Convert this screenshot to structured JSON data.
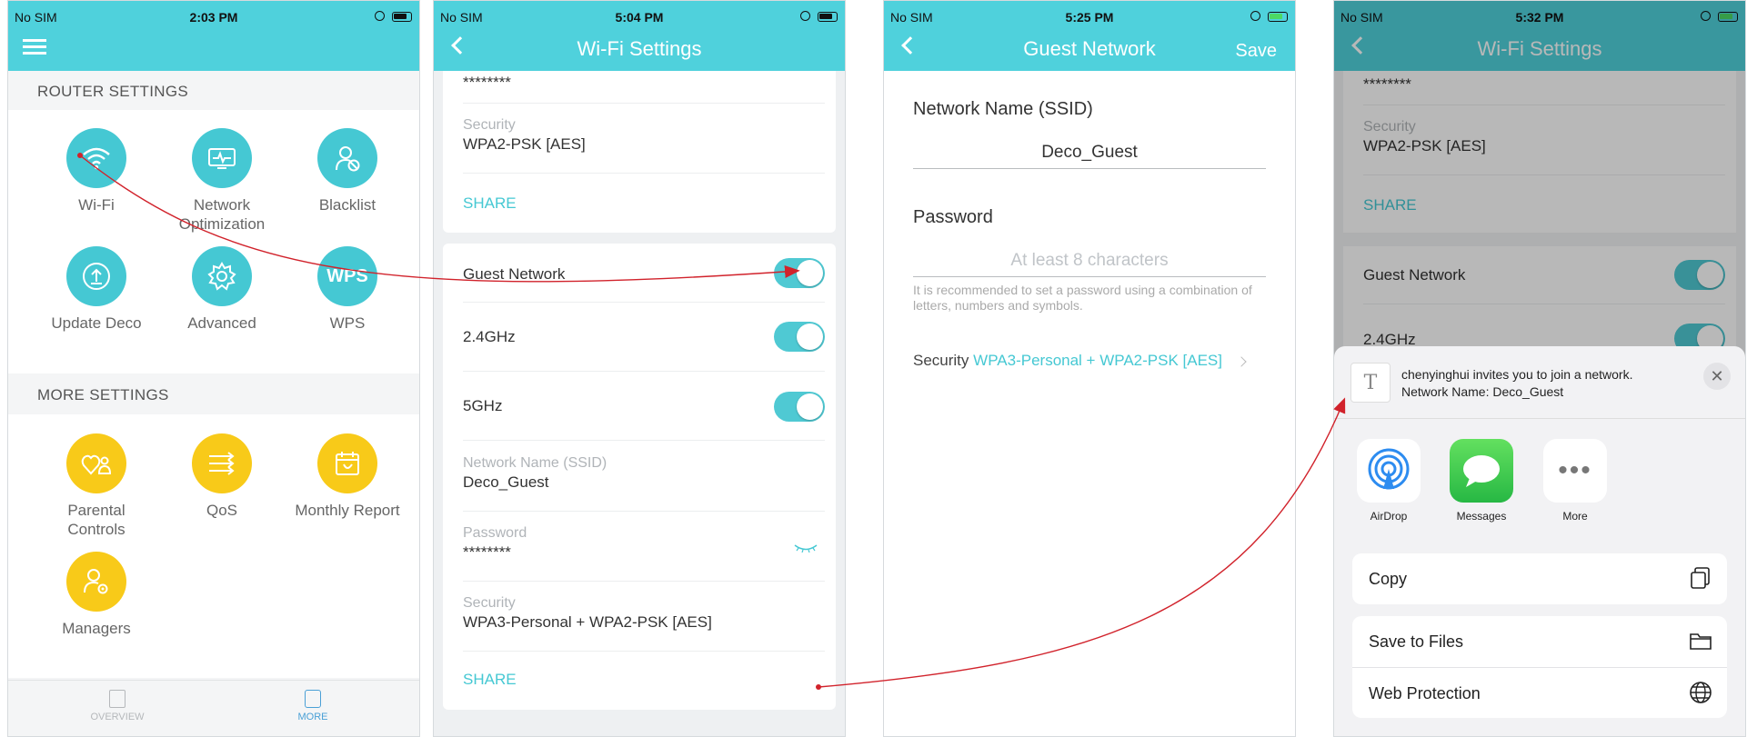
{
  "colors": {
    "accent": "#4fd1dc",
    "yellow": "#f8ca19",
    "arrow": "#d1222b",
    "link": "#45c8d3"
  },
  "phone1": {
    "status": {
      "carrier": "No SIM",
      "time": "2:03 PM"
    },
    "menu_icon": "hamburger-icon",
    "router_settings_label": "ROUTER SETTINGS",
    "router_tiles": [
      {
        "label": "Wi-Fi",
        "icon": "wifi-icon"
      },
      {
        "label": "Network Optimization",
        "icon": "network-optimization-icon"
      },
      {
        "label": "Blacklist",
        "icon": "blacklist-icon"
      },
      {
        "label": "Update Deco",
        "icon": "upload-icon"
      },
      {
        "label": "Advanced",
        "icon": "gear-icon"
      },
      {
        "label": "WPS",
        "icon": "wps-icon",
        "badge": "WPS"
      }
    ],
    "more_settings_label": "MORE SETTINGS",
    "more_tiles": [
      {
        "label": "Parental Controls",
        "icon": "parental-controls-icon"
      },
      {
        "label": "QoS",
        "icon": "qos-icon"
      },
      {
        "label": "Monthly Report",
        "icon": "calendar-icon"
      },
      {
        "label": "Managers",
        "icon": "managers-icon"
      }
    ],
    "tabbar": {
      "overview": "OVERVIEW",
      "more": "MORE"
    }
  },
  "phone2": {
    "status": {
      "carrier": "No SIM",
      "time": "5:04 PM"
    },
    "title": "Wi-Fi Settings",
    "top_password": "********",
    "top_security_label": "Security",
    "top_security_value": "WPA2-PSK [AES]",
    "share": "SHARE",
    "guest_network": "Guest Network",
    "band_24": "2.4GHz",
    "band_5": "5GHz",
    "ssid_label": "Network Name (SSID)",
    "ssid_value": "Deco_Guest",
    "password_label": "Password",
    "password_value": "********",
    "security_label": "Security",
    "security_value": "WPA3-Personal + WPA2-PSK [AES]",
    "share2": "SHARE"
  },
  "phone3": {
    "status": {
      "carrier": "No SIM",
      "time": "5:25 PM"
    },
    "title": "Guest Network",
    "save": "Save",
    "ssid_label": "Network Name (SSID)",
    "ssid_value": "Deco_Guest",
    "password_label": "Password",
    "password_placeholder": "At least 8 characters",
    "hint": "It is recommended to set a password using a combination of letters, numbers and symbols.",
    "security_label": "Security",
    "security_value": "WPA3-Personal + WPA2-PSK [AES]"
  },
  "phone4": {
    "status": {
      "carrier": "No SIM",
      "time": "5:32 PM"
    },
    "title": "Wi-Fi Settings",
    "top_password": "********",
    "security_label": "Security",
    "security_value": "WPA2-PSK [AES]",
    "share": "SHARE",
    "guest_network": "Guest Network",
    "band_24": "2.4GHz",
    "sheet": {
      "doc_glyph": "T",
      "invite_line1": "chenyinghui invites you to join a network.",
      "invite_line2": "Network Name: Deco_Guest",
      "apps": [
        "AirDrop",
        "Messages",
        "More"
      ],
      "copy": "Copy",
      "save_to_files": "Save to Files",
      "web_protection": "Web Protection"
    }
  }
}
